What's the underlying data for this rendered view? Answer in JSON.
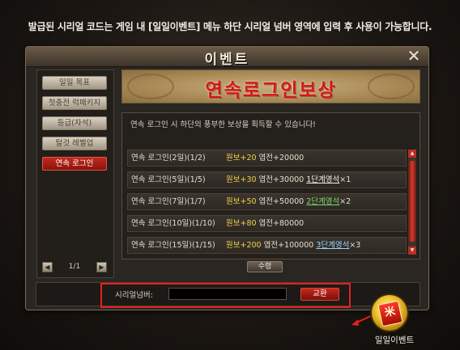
{
  "notice": "발급된 시리얼 코드는 게임 내 [일일이벤트] 메뉴 하단 시리얼  넘버 영역에 입력 후 사용이 가능합니다.",
  "window": {
    "title": "이벤트",
    "close_icon": "close-icon"
  },
  "sidebar": {
    "tabs": [
      {
        "label": "일일 목표",
        "active": false
      },
      {
        "label": "첫충전 럭패키지",
        "active": false
      },
      {
        "label": "등급(자석)",
        "active": false
      },
      {
        "label": "탈것 레벨업",
        "active": false
      },
      {
        "label": "연속 로그인",
        "active": true
      }
    ],
    "pager": {
      "text": "1/1",
      "prev_icon": "prev-arrow-icon",
      "next_icon": "next-arrow-icon"
    }
  },
  "banner": {
    "title": "연속로그인보상"
  },
  "description": "연속 로그인 시 하단의 풍부한 보상을 획득할 수 있습니다!",
  "rewards": [
    {
      "label": "연속 로그인(2일)(1/2)",
      "main": "원보+20",
      "rest": " 엽전+20000",
      "item": "",
      "item_qty": ""
    },
    {
      "label": "연속 로그인(5일)(1/5)",
      "main": "원보+30",
      "rest": " 엽전+30000 ",
      "item": "1단계영석",
      "item_qty": "×1"
    },
    {
      "label": "연속 로그인(7일)(1/7)",
      "main": "원보+50",
      "rest": " 엽전+50000 ",
      "item": "2단계영석",
      "item_qty": "×2"
    },
    {
      "label": "연속 로그인(10일)(1/10)",
      "main": "원보+80",
      "rest": " 엽전+80000",
      "item": "",
      "item_qty": ""
    },
    {
      "label": "연속 로그인(15일)(1/15)",
      "main": "원보+200",
      "rest": " 엽전+100000 ",
      "item": "3단계영석",
      "item_qty": "×3"
    }
  ],
  "receive_button": "수령",
  "serial": {
    "label": "시리얼넘버:",
    "value": "",
    "placeholder": "",
    "button": "교환"
  },
  "event_icon": {
    "label": "일일이벤트",
    "glyph": "米"
  },
  "colors": {
    "highlight": "#e81e1e",
    "accent_red": "#c32a1c",
    "gold": "#f0d24a"
  }
}
